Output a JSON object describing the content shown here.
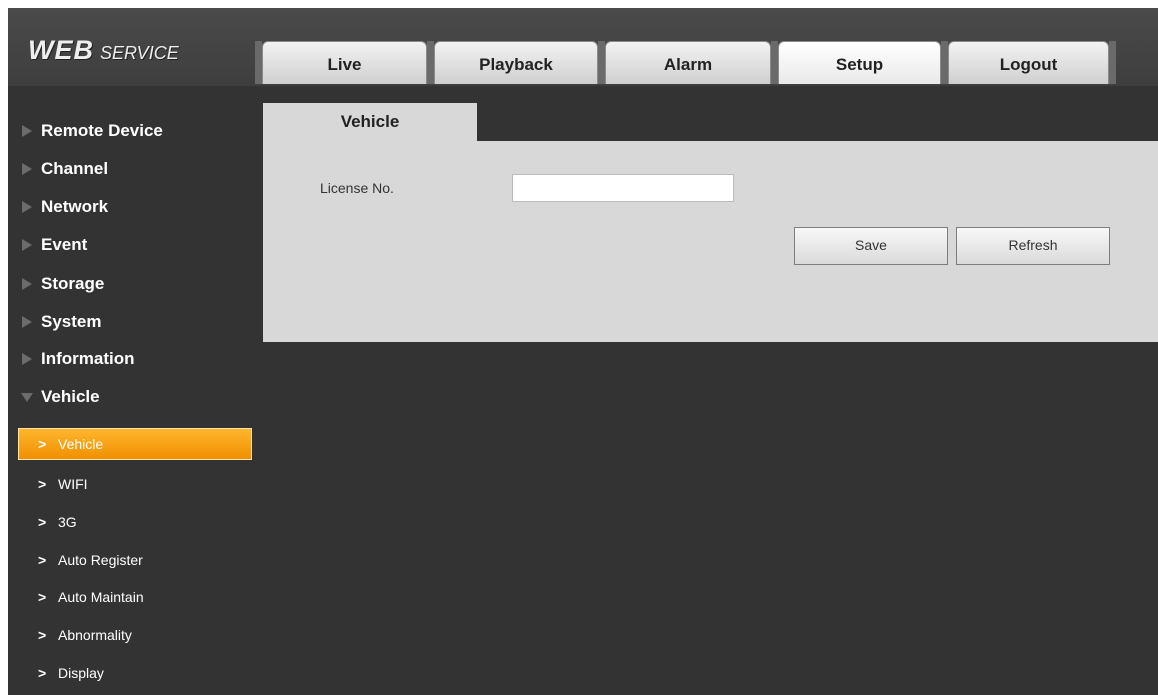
{
  "brand": {
    "word1": "WEB",
    "word2": "SERVICE"
  },
  "nav": {
    "tabs": [
      {
        "label": "Live"
      },
      {
        "label": "Playback"
      },
      {
        "label": "Alarm"
      },
      {
        "label": "Setup",
        "active": true
      },
      {
        "label": "Logout"
      }
    ]
  },
  "sidebar": {
    "categories": [
      {
        "label": "Remote Device",
        "expanded": false
      },
      {
        "label": "Channel",
        "expanded": false
      },
      {
        "label": "Network",
        "expanded": false
      },
      {
        "label": "Event",
        "expanded": false
      },
      {
        "label": "Storage",
        "expanded": false
      },
      {
        "label": "System",
        "expanded": false
      },
      {
        "label": "Information",
        "expanded": false
      },
      {
        "label": "Vehicle",
        "expanded": true
      }
    ],
    "subitems": [
      {
        "label": "Vehicle",
        "active": true
      },
      {
        "label": "WIFI"
      },
      {
        "label": "3G"
      },
      {
        "label": "Auto Register"
      },
      {
        "label": "Auto Maintain"
      },
      {
        "label": "Abnormality"
      },
      {
        "label": "Display"
      }
    ],
    "chevron": ">"
  },
  "content": {
    "tab_label": "Vehicle",
    "license_label": "License No.",
    "license_value": "",
    "save_label": "Save",
    "refresh_label": "Refresh"
  },
  "colors": {
    "background": "#333333",
    "panel": "#d8d8d8",
    "active_item": "#f7a412",
    "text_light": "#ffffff"
  }
}
